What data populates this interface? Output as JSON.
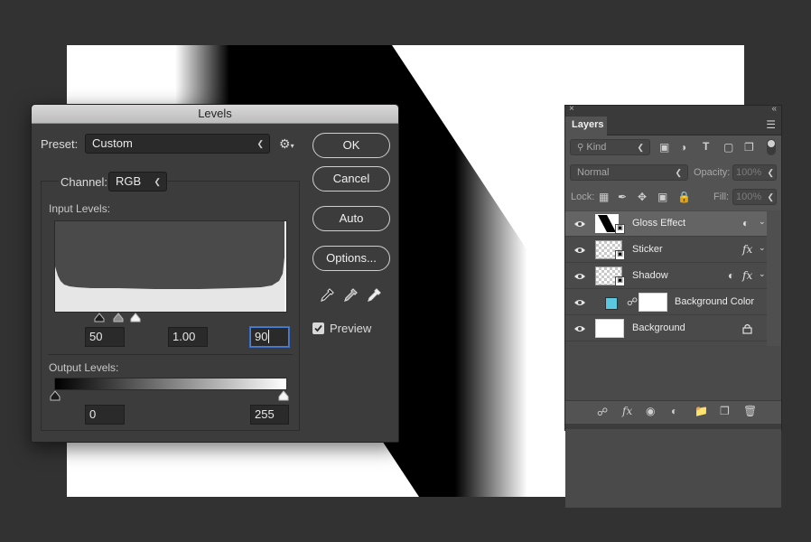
{
  "levels_dialog": {
    "title": "Levels",
    "preset_label": "Preset:",
    "preset_value": "Custom",
    "channel_label": "Channel:",
    "channel_value": "RGB",
    "input_levels_label": "Input Levels:",
    "input_black": "50",
    "input_gamma": "1.00",
    "input_white": "90",
    "output_levels_label": "Output Levels:",
    "output_black": "0",
    "output_white": "255",
    "buttons": {
      "ok": "OK",
      "cancel": "Cancel",
      "auto": "Auto",
      "options": "Options..."
    },
    "preview_label": "Preview",
    "preview_checked": true
  },
  "layers_panel": {
    "tab_title": "Layers",
    "filter_kind": "Kind",
    "blend_mode": "Normal",
    "opacity_label": "Opacity:",
    "opacity_value": "100%",
    "lock_label": "Lock:",
    "fill_label": "Fill:",
    "fill_value": "100%",
    "layers": [
      {
        "name": "Gloss Effect",
        "selected": true,
        "badge": "adjustment-link-icon"
      },
      {
        "name": "Sticker",
        "badge": "fx-icon"
      },
      {
        "name": "Shadow",
        "badge": "adjustment-link-icon"
      },
      {
        "name": "Background Color",
        "fill_color": "#5bc7e0"
      },
      {
        "name": "Background",
        "locked": true
      }
    ]
  },
  "colors": {
    "app_bg": "#323232",
    "dialog_bg": "#3c3c3c",
    "panel_bg": "#535353",
    "selected_layer": "#646464",
    "focus_blue": "#4a7fd6",
    "swatch_cyan": "#5bc7e0"
  }
}
